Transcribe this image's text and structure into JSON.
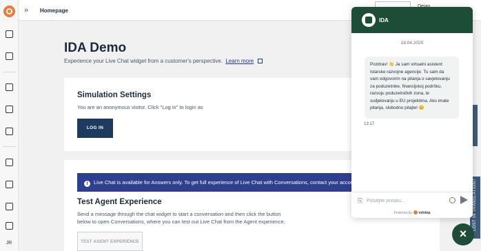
{
  "topbar": {
    "breadcrumb": "Homepage",
    "user_text": "Dejan"
  },
  "rail": {
    "avatar_initials": "JR"
  },
  "main": {
    "title": "IDA Demo",
    "subtitle": "Experience your Live Chat widget from a customer's perspective.",
    "learn_more": "Learn more",
    "simulation": {
      "heading": "Simulation Settings",
      "text": "You are an anonymous visitor. Click \"Log in\" to login as",
      "login_button": "LOG IN"
    },
    "agent": {
      "banner": "Live Chat is available for Answers only. To get full experience of Live Chat with Conversations, contact your account",
      "heading": "Test Agent Experience",
      "text": "Send a message through the chat widget to start a conversation and then click the button below to open Conversations, where you can test out Live Chat from the Agent experience.",
      "button": "TEST AGENT EXPERIENCE"
    }
  },
  "side": {
    "lost_tab": "LOST IN TRANSLATION?"
  },
  "widget": {
    "agent_name": "IDA",
    "date": "18.04.2025",
    "message": "Pozdrav! 👋 Ja sam virtualni asistent Istarske razvojne agencije. Tu sam da vam odgovorim na pitanja o savjetovanju za poduzetnike, financijskoj podršku, razvoju poduzetničkih zona, te sudjelovanju u EU projektima. Ako imate pitanja, slobodno pitajte! 😊",
    "time": "13:17",
    "input_placeholder": "Pošaljite poruku...",
    "powered_by": "Powered by",
    "brand": "infobip"
  },
  "fab": {
    "label": "×"
  },
  "colors": {
    "brand_green": "#1e4d37",
    "banner_blue": "#2e3f8f",
    "login_navy": "#1e3a5f",
    "logo_orange": "#f07a3a"
  }
}
